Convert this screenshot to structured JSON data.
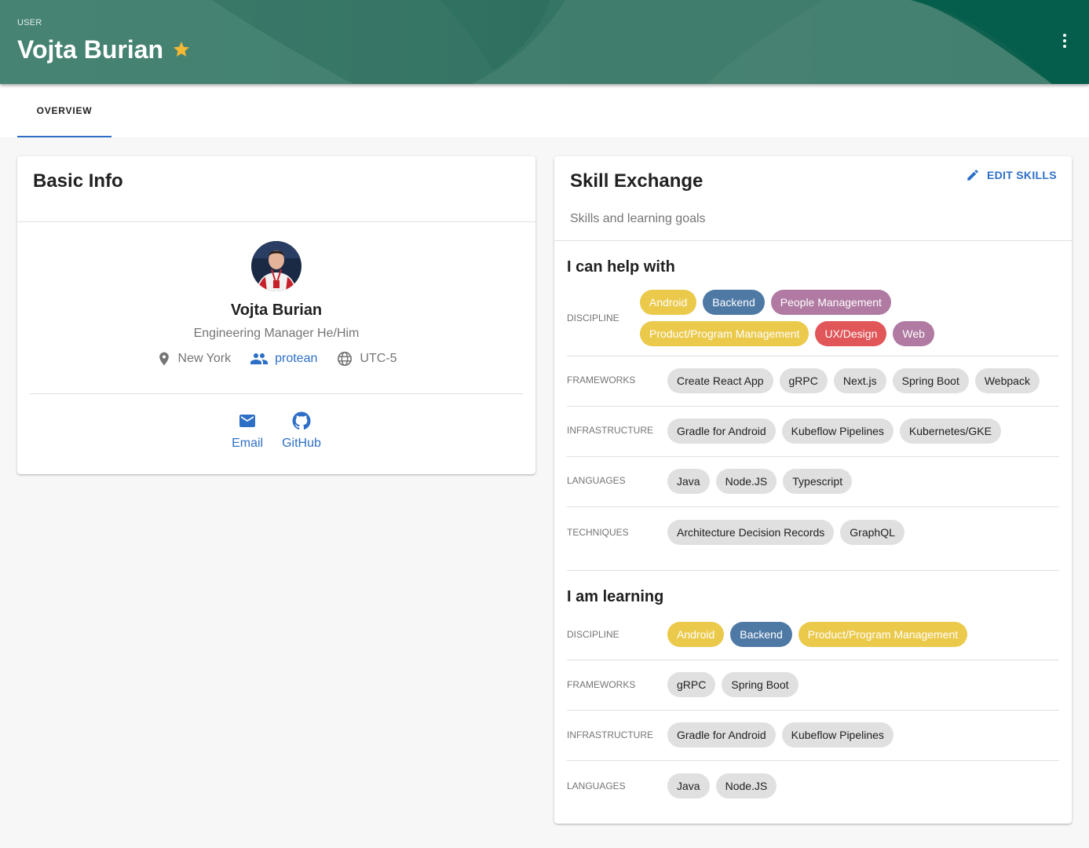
{
  "header": {
    "kicker": "USER",
    "title": "Vojta Burian",
    "favorite_icon": "star-icon",
    "menu_icon": "more-vert-icon",
    "colors": {
      "banner": "#1f6b5b",
      "star": "#f4b934"
    }
  },
  "tabs": [
    {
      "label": "OVERVIEW",
      "active": true
    }
  ],
  "basic_info": {
    "title": "Basic Info",
    "avatar_alt": "Profile photo of Vojta Burian",
    "name": "Vojta Burian",
    "role": "Engineering Manager He/Him",
    "location": {
      "icon": "location-pin-icon",
      "text": "New York"
    },
    "team": {
      "icon": "people-icon",
      "text": "protean"
    },
    "timezone": {
      "icon": "globe-icon",
      "text": "UTC-5"
    },
    "contacts": [
      {
        "icon": "email-icon",
        "label": "Email"
      },
      {
        "icon": "github-icon",
        "label": "GitHub"
      }
    ]
  },
  "skills": {
    "title": "Skill Exchange",
    "subtitle": "Skills and learning goals",
    "edit_label": "EDIT SKILLS",
    "colors": {
      "accent": "#2d6fc6",
      "yellow": "#ebc94b",
      "blue": "#4f79a5",
      "purple": "#b07aa2",
      "red": "#e05659",
      "grey": "#e0e0e0"
    },
    "can_help": {
      "heading": "I can help with",
      "rows": [
        {
          "category": "DISCIPLINE",
          "chips": [
            {
              "label": "Android",
              "color": "yellow"
            },
            {
              "label": "Backend",
              "color": "blue"
            },
            {
              "label": "People Management",
              "color": "purple"
            },
            {
              "label": "Product/Program Management",
              "color": "yellow"
            },
            {
              "label": "UX/Design",
              "color": "red"
            },
            {
              "label": "Web",
              "color": "purple"
            }
          ]
        },
        {
          "category": "FRAMEWORKS",
          "chips": [
            {
              "label": "Create React App"
            },
            {
              "label": "gRPC"
            },
            {
              "label": "Next.js"
            },
            {
              "label": "Spring Boot"
            },
            {
              "label": "Webpack"
            }
          ]
        },
        {
          "category": "INFRASTRUCTURE",
          "chips": [
            {
              "label": "Gradle for Android"
            },
            {
              "label": "Kubeflow Pipelines"
            },
            {
              "label": "Kubernetes/GKE"
            }
          ]
        },
        {
          "category": "LANGUAGES",
          "chips": [
            {
              "label": "Java"
            },
            {
              "label": "Node.JS"
            },
            {
              "label": "Typescript"
            }
          ]
        },
        {
          "category": "TECHNIQUES",
          "chips": [
            {
              "label": "Architecture Decision Records"
            },
            {
              "label": "GraphQL"
            }
          ]
        }
      ]
    },
    "learning": {
      "heading": "I am learning",
      "rows": [
        {
          "category": "DISCIPLINE",
          "chips": [
            {
              "label": "Android",
              "color": "yellow"
            },
            {
              "label": "Backend",
              "color": "blue"
            },
            {
              "label": "Product/Program Management",
              "color": "yellow"
            }
          ]
        },
        {
          "category": "FRAMEWORKS",
          "chips": [
            {
              "label": "gRPC"
            },
            {
              "label": "Spring Boot"
            }
          ]
        },
        {
          "category": "INFRASTRUCTURE",
          "chips": [
            {
              "label": "Gradle for Android"
            },
            {
              "label": "Kubeflow Pipelines"
            }
          ]
        },
        {
          "category": "LANGUAGES",
          "chips": [
            {
              "label": "Java"
            },
            {
              "label": "Node.JS"
            }
          ]
        }
      ]
    }
  }
}
